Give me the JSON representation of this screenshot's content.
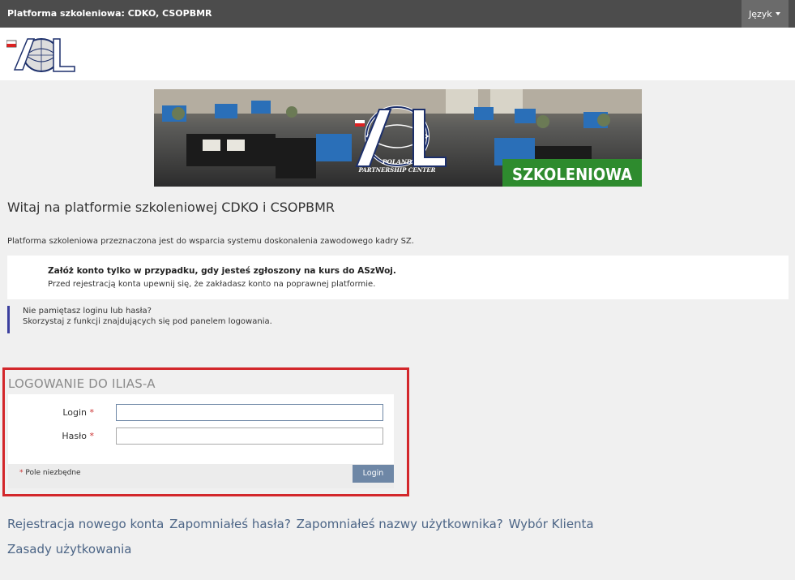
{
  "header": {
    "title": "Platforma szkoleniowa: CDKO, CSOPBMR",
    "language_label": "Język"
  },
  "logo": {
    "icon": "adl-logo-icon"
  },
  "banner": {
    "logo_text": "ADL",
    "subtitle_line1": "POLAND",
    "subtitle_line2": "PARTNERSHIP CENTER",
    "label": "SZKOLENIOWA"
  },
  "main": {
    "welcome": "Witaj na platformie szkoleniowej CDKO i CSOPBMR",
    "intro": "Platforma szkoleniowa przeznaczona jest do wsparcia systemu doskonalenia zawodowego kadry SZ.",
    "notice_bold": "Załóż konto tylko w przypadku, gdy jesteś zgłoszony na kurs do ASzWoj.",
    "notice_text": "Przed rejestracją konta upewnij się, że zakładasz konto na poprawnej platformie.",
    "hint_line1": "Nie pamiętasz loginu lub hasła?",
    "hint_line2": "Skorzystaj z funkcji znajdujących się pod panelem logowania."
  },
  "login": {
    "heading": "LOGOWANIE DO ILIAS-A",
    "login_label": "Login",
    "password_label": "Hasło",
    "required_mark": "*",
    "login_value": "",
    "password_value": "",
    "required_note": "Pole niezbędne",
    "submit_label": "Login"
  },
  "links": {
    "register": "Rejestracja nowego konta",
    "forgot_password": "Zapomniałeś hasła?",
    "forgot_username": "Zapomniałeś nazwy użytkownika?",
    "client_select": "Wybór Klienta",
    "terms": "Zasady użytkowania"
  },
  "colors": {
    "topbar": "#4c4c4c",
    "accent": "#6e87a6",
    "link": "#4c6586",
    "highlight": "#d3272b",
    "banner_green": "#2e8b2e"
  }
}
